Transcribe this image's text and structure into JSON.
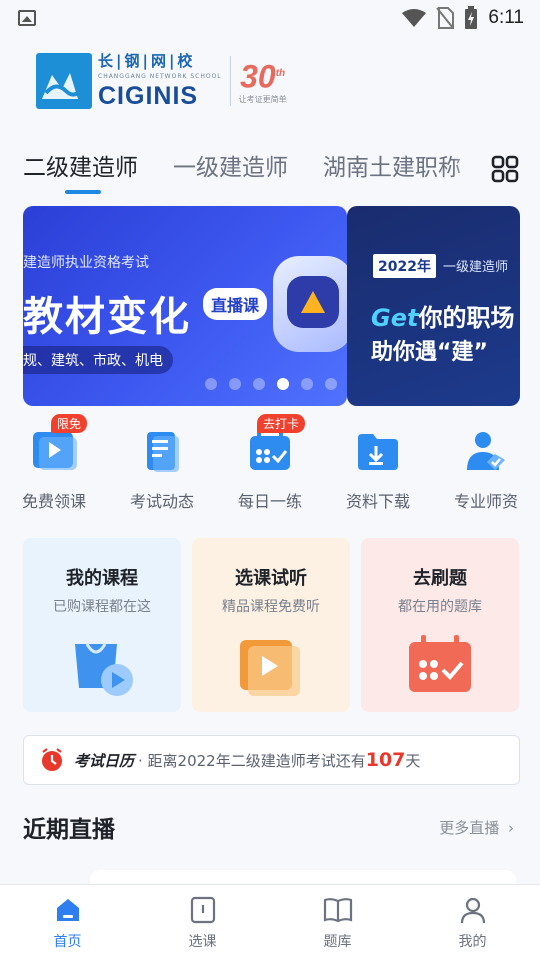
{
  "status_bar": {
    "time": "6:11"
  },
  "logo": {
    "cn_name": "长|钢|网|校",
    "en_small": "CHANGGANG NETWORK SCHOOL",
    "en_name": "CIGINIS",
    "anniversary": "30",
    "anniversary_sup": "th",
    "slogan": "让考证更简单"
  },
  "tabs": [
    {
      "label": "二级建造师",
      "active": true
    },
    {
      "label": "一级建造师",
      "active": false
    },
    {
      "label": "湖南土建职称",
      "active": false
    }
  ],
  "banner": {
    "main": {
      "subtitle": "建造师执业资格考试",
      "title": "教材变化",
      "tag": "直播课",
      "bottom": "规、建筑、市政、机电"
    },
    "side": {
      "year": "2022年",
      "year_label": "一级建造师",
      "line1_highlight": "Get",
      "line1": "你的职场",
      "line2": "助你遇“建”"
    },
    "dot_count": 6,
    "active_dot": 3
  },
  "quick_links": [
    {
      "label": "免费领课",
      "badge": "限免",
      "icon": "play-video-icon"
    },
    {
      "label": "考试动态",
      "badge": "",
      "icon": "document-list-icon"
    },
    {
      "label": "每日一练",
      "badge": "去打卡",
      "icon": "calendar-check-icon"
    },
    {
      "label": "资料下载",
      "badge": "",
      "icon": "folder-download-icon"
    },
    {
      "label": "专业师资",
      "badge": "",
      "icon": "teacher-icon"
    }
  ],
  "cards": [
    {
      "title": "我的课程",
      "subtitle": "已购课程都在这",
      "icon": "shopping-bag-play-icon"
    },
    {
      "title": "选课试听",
      "subtitle": "精品课程免费听",
      "icon": "video-play-icon"
    },
    {
      "title": "去刷题",
      "subtitle": "都在用的题库",
      "icon": "calendar-check-icon"
    }
  ],
  "exam_calendar": {
    "logo": "考试日历",
    "prefix": "· 距离2022年二级建造师考试还有",
    "days": "107",
    "suffix": "天"
  },
  "recent_live": {
    "title": "近期直播",
    "more": "更多直播"
  },
  "bottom_nav": [
    {
      "label": "首页",
      "active": true,
      "icon": "home-icon"
    },
    {
      "label": "选课",
      "active": false,
      "icon": "course-book-icon"
    },
    {
      "label": "题库",
      "active": false,
      "icon": "open-book-icon"
    },
    {
      "label": "我的",
      "active": false,
      "icon": "user-profile-icon"
    }
  ],
  "colors": {
    "accent": "#1e88e5",
    "badge": "#f0412f",
    "countdown": "#e8382b",
    "card_blue": "#e9f3fd",
    "card_orange": "#fdf1e4",
    "card_red": "#fde9e7"
  }
}
